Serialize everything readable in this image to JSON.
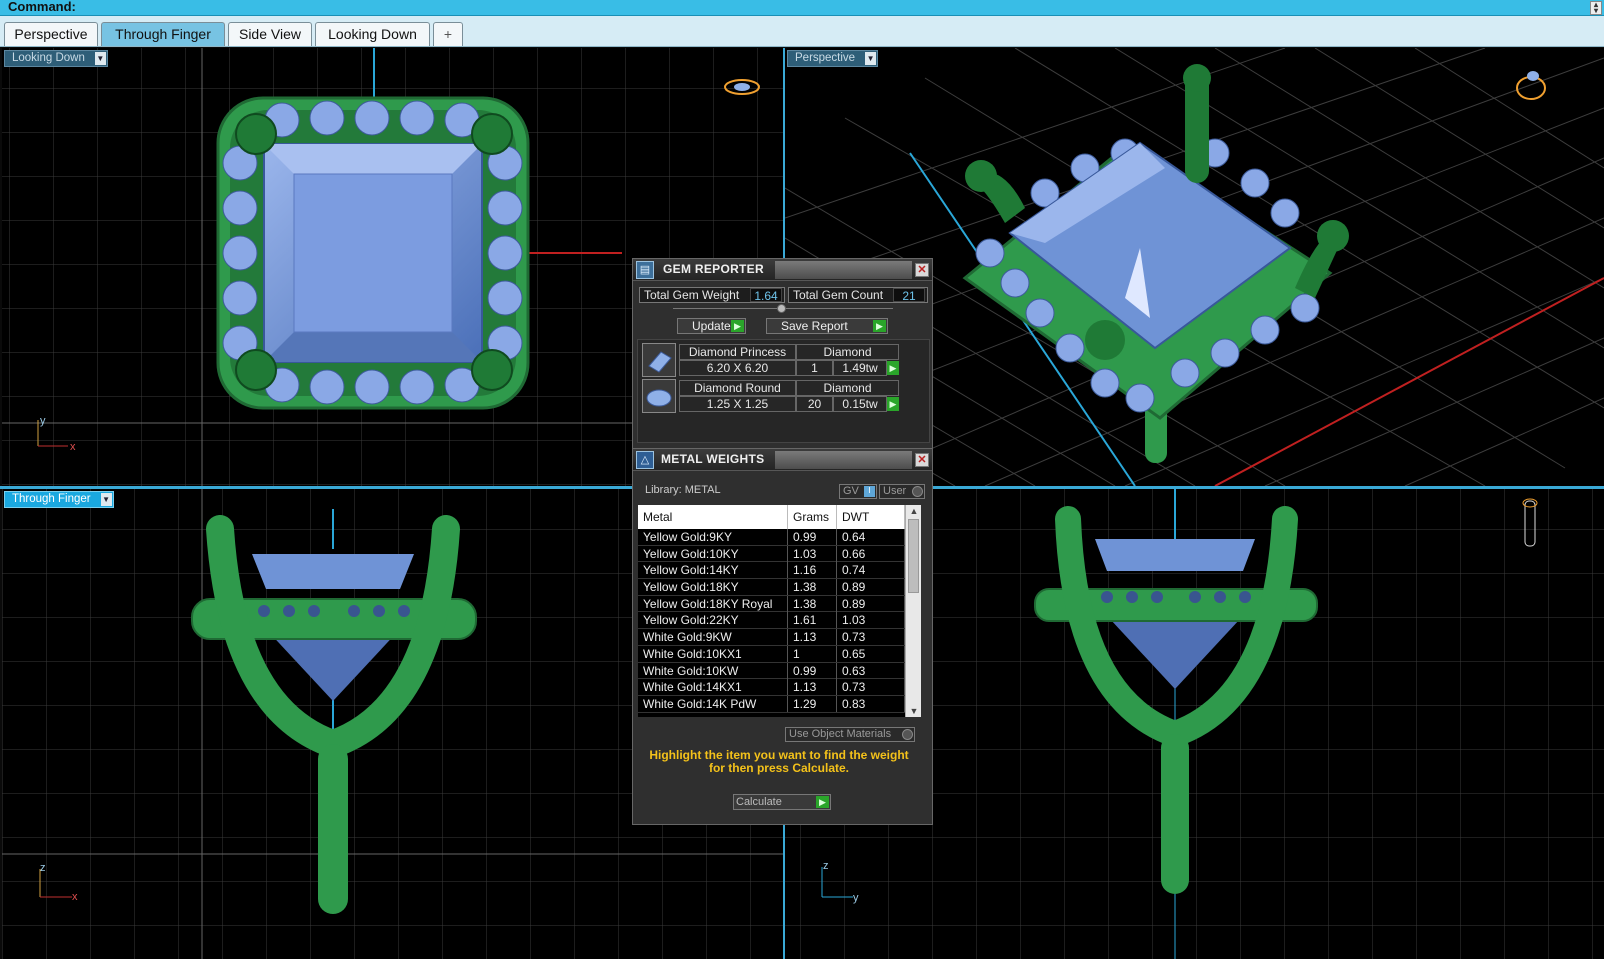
{
  "command": {
    "label": "Command:"
  },
  "tabs": [
    {
      "label": "Perspective",
      "active": false
    },
    {
      "label": "Through Finger",
      "active": true
    },
    {
      "label": "Side View",
      "active": false
    },
    {
      "label": "Looking Down",
      "active": false
    },
    {
      "label": "+",
      "active": false
    }
  ],
  "viewports": {
    "top_left": {
      "label": "Looking Down",
      "axis_v": "y",
      "axis_h": "x"
    },
    "top_right": {
      "label": "Perspective"
    },
    "bottom_left": {
      "label": "Through Finger",
      "axis_v": "z",
      "axis_h": "x"
    },
    "bottom_right": {
      "label": "",
      "axis_v": "z",
      "axis_h": "y"
    }
  },
  "gem_reporter": {
    "title": "GEM REPORTER",
    "total_weight_label": "Total Gem Weight",
    "total_weight": "1.64",
    "total_count_label": "Total Gem Count",
    "total_count": "21",
    "update_label": "Update",
    "save_label": "Save Report",
    "gems": [
      {
        "name": "Diamond Princess",
        "material": "Diamond",
        "size": "6.20 X 6.20",
        "count": "1",
        "weight": "1.49tw"
      },
      {
        "name": "Diamond Round",
        "material": "Diamond",
        "size": "1.25 X 1.25",
        "count": "20",
        "weight": "0.15tw"
      }
    ]
  },
  "metal_weights": {
    "title": "METAL WEIGHTS",
    "library_label": "Library: METAL",
    "gv_label": "GV",
    "user_label": "User",
    "columns": [
      "Metal",
      "Grams",
      "DWT"
    ],
    "rows": [
      [
        "Yellow Gold:9KY",
        "0.99",
        "0.64"
      ],
      [
        "Yellow Gold:10KY",
        "1.03",
        "0.66"
      ],
      [
        "Yellow Gold:14KY",
        "1.16",
        "0.74"
      ],
      [
        "Yellow Gold:18KY",
        "1.38",
        "0.89"
      ],
      [
        "Yellow Gold:18KY Royal",
        "1.38",
        "0.89"
      ],
      [
        "Yellow Gold:22KY",
        "1.61",
        "1.03"
      ],
      [
        "White Gold:9KW",
        "1.13",
        "0.73"
      ],
      [
        "White Gold:10KX1",
        "1",
        "0.65"
      ],
      [
        "White Gold:10KW",
        "0.99",
        "0.63"
      ],
      [
        "White Gold:14KX1",
        "1.13",
        "0.73"
      ],
      [
        "White Gold:14K PdW",
        "1.29",
        "0.83"
      ]
    ],
    "use_object_materials": "Use Object Materials",
    "hint": "Highlight the item you want to find the weight for then press Calculate.",
    "calculate_label": "Calculate"
  },
  "colors": {
    "accent": "#39bde6",
    "metal_green": "#2f9a4c",
    "gem_blue": "#6f93d6"
  }
}
